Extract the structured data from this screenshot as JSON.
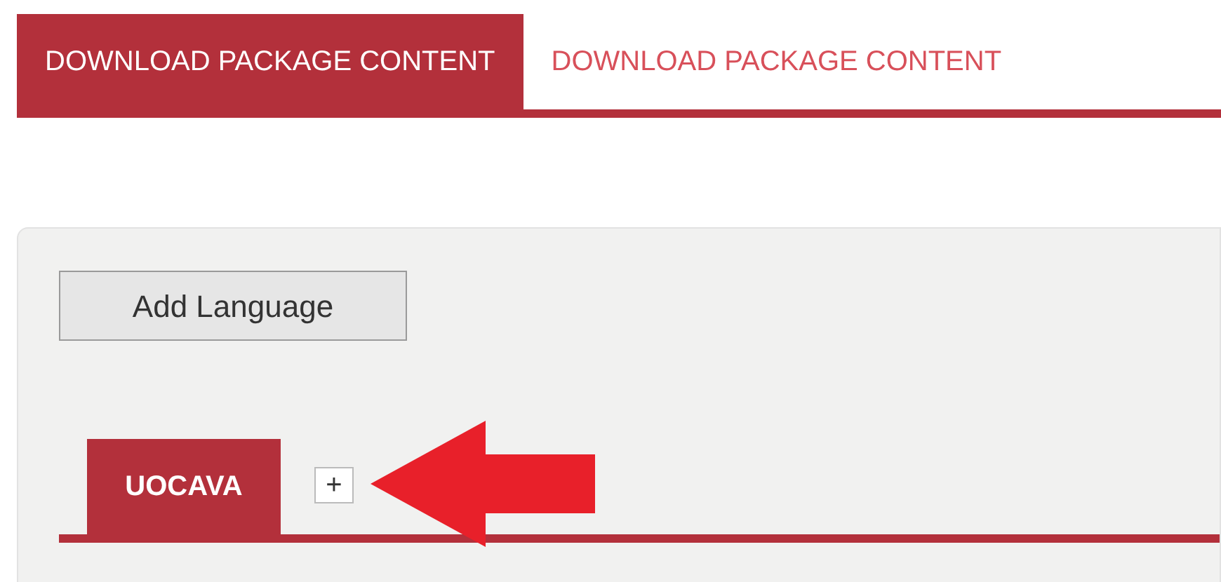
{
  "tabs": [
    {
      "label": "DOWNLOAD PACKAGE CONTENT",
      "selected": true
    },
    {
      "label": "DOWNLOAD PACKAGE CONTENT",
      "selected": false
    }
  ],
  "panel": {
    "add_button": "Add Language",
    "language_tabs": [
      {
        "label": "UOCAVA",
        "selected": true
      }
    ],
    "add_tab_button": "+"
  }
}
